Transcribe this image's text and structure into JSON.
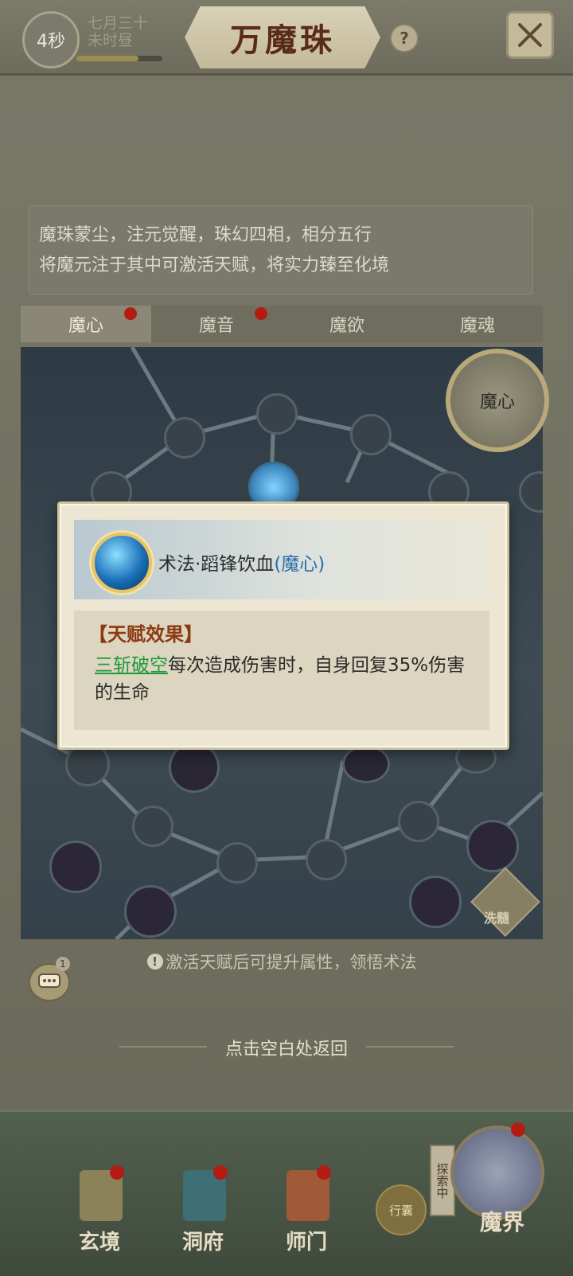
{
  "header": {
    "timer": "4秒",
    "date_line1": "七月三十",
    "date_line2": "未时昼",
    "title": "万魔珠",
    "help": "?",
    "progress": 0.72
  },
  "description": {
    "line1": "魔珠蒙尘，注元觉醒，珠幻四相，相分五行",
    "line2": "将魔元注于其中可激活天赋，将实力臻至化境"
  },
  "tabs": [
    {
      "label": "魔心",
      "active": true,
      "badge": true
    },
    {
      "label": "魔音",
      "active": false,
      "badge": true
    },
    {
      "label": "魔欲",
      "active": false,
      "badge": false
    },
    {
      "label": "魔魂",
      "active": false,
      "badge": false
    }
  ],
  "tree": {
    "core_label": "魔心",
    "wash_label": "洗髓"
  },
  "popup": {
    "skill_name": "术法·蹈锋饮血",
    "skill_tag": "(魔心)",
    "effect_title": "【天赋效果】",
    "effect_link": "三斩破空",
    "effect_text": "每次造成伤害时，自身回复35%伤害的生命"
  },
  "hint": "激活天赋后可提升属性，领悟术法",
  "chat_count": "1",
  "return_text": "点击空白处返回",
  "nav": [
    {
      "label": "玄境",
      "badge": true
    },
    {
      "label": "洞府",
      "badge": true
    },
    {
      "label": "师门",
      "badge": true
    }
  ],
  "bag_label": "行囊",
  "explore_label": "探索中",
  "world_label": "魔界",
  "colors": {
    "badge_red": "#b41b12",
    "link_green": "#1e9a3a",
    "tag_blue": "#2a6ca8",
    "effect_title": "#8b3a12"
  }
}
